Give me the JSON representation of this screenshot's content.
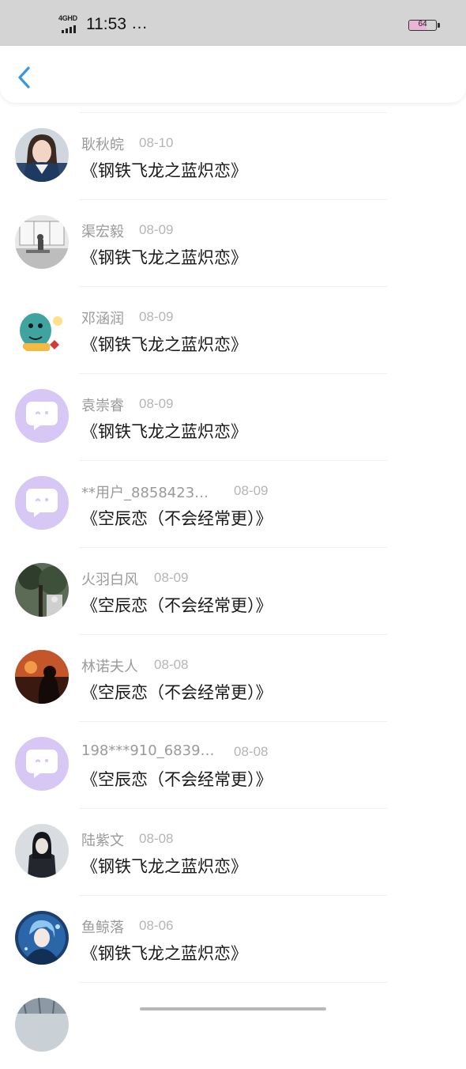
{
  "status_bar": {
    "network": "4GHD",
    "time": "11:53",
    "more": "…",
    "battery_level": 64,
    "battery_label": "64"
  },
  "header": {
    "back_icon": "chevron-left-icon",
    "accent_color": "#3a96e0"
  },
  "items": [
    {
      "name": "耿秋皖",
      "date": "08-10",
      "title": "《钢铁飞龙之蓝炽恋》",
      "avatar": "photo-girl"
    },
    {
      "name": "渠宏毅",
      "date": "08-09",
      "title": "《钢铁飞龙之蓝炽恋》",
      "avatar": "photo-office"
    },
    {
      "name": "邓涵润",
      "date": "08-09",
      "title": "《钢铁飞龙之蓝炽恋》",
      "avatar": "sticker-dinosaur"
    },
    {
      "name": "袁崇睿",
      "date": "08-09",
      "title": "《钢铁飞龙之蓝炽恋》",
      "avatar": "default-chat"
    },
    {
      "name": "**用户_8858423…",
      "date": "08-09",
      "title": "《空辰恋（不会经常更）》",
      "avatar": "default-chat"
    },
    {
      "name": "火羽白风",
      "date": "08-09",
      "title": "《空辰恋（不会经常更）》",
      "avatar": "photo-tree"
    },
    {
      "name": "林诺夫人",
      "date": "08-08",
      "title": "《空辰恋（不会经常更）》",
      "avatar": "photo-sunset"
    },
    {
      "name": "198***910_6839…",
      "date": "08-08",
      "title": "《空辰恋（不会经常更）》",
      "avatar": "default-chat"
    },
    {
      "name": "陆紫文",
      "date": "08-08",
      "title": "《钢铁飞龙之蓝炽恋》",
      "avatar": "photo-dark"
    },
    {
      "name": "鱼鲸落",
      "date": "08-06",
      "title": "《钢铁飞龙之蓝炽恋》",
      "avatar": "anime-blue"
    },
    {
      "name": "",
      "date": "",
      "title": "",
      "avatar": "photo-partial"
    }
  ]
}
